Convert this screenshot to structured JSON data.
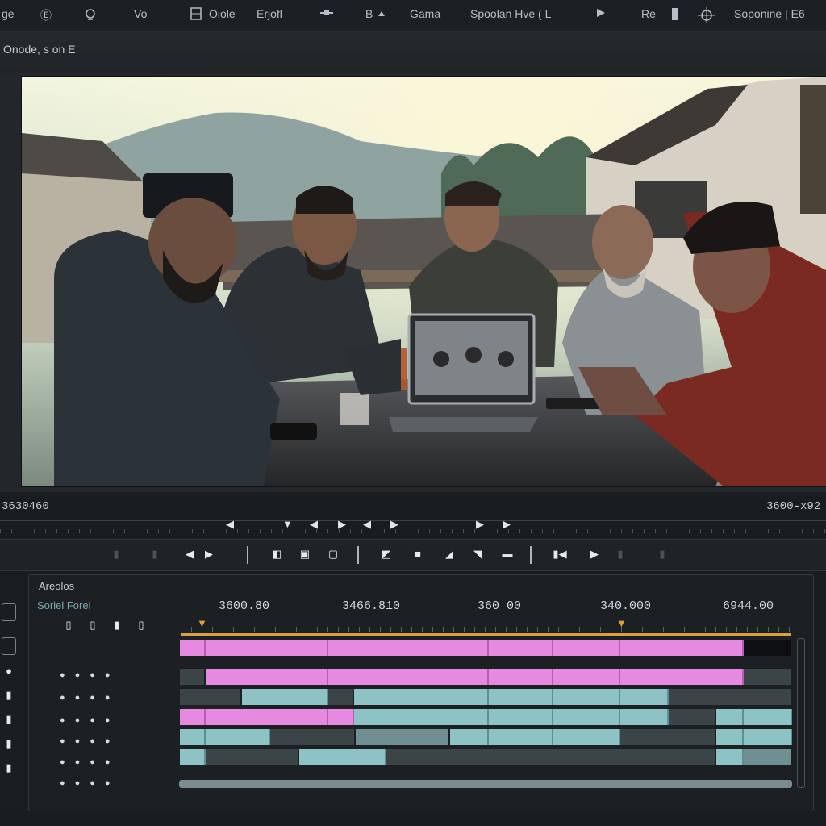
{
  "menu": {
    "items": [
      "ge",
      "Ⓔ",
      "",
      "Vo",
      "",
      "Oiole",
      "Erjofl",
      "",
      "B",
      "Gama",
      "Spoolan Hve ( L",
      "",
      "Re",
      "",
      "Soponine | E6"
    ]
  },
  "window": {
    "title": "Onode, s on E"
  },
  "viewer": {
    "timecode_left": "3630460",
    "timecode_right": "3600-x92"
  },
  "timeline": {
    "header_title": "Areolos",
    "header_subtitle": "Soriel Forel",
    "ruler_labels": [
      "3600.80",
      "3466.810",
      "360 00",
      "340.000",
      "6944.00"
    ]
  },
  "colors": {
    "accent": "#d9a23a",
    "clip_pink": "#e58ae0",
    "clip_teal": "#8ec3c6"
  },
  "icons": {
    "transport": [
      "skip-back-icon",
      "marker-icon",
      "step-back-icon",
      "play-icon",
      "step-back-icon",
      "play-icon",
      "play-icon",
      "play-icon"
    ],
    "tools": [
      "clip-icon",
      "film-icon",
      "frame-icon",
      "trim-icon",
      "stop-icon",
      "slip-icon",
      "razor-icon",
      "line-icon",
      "mark-in-icon",
      "play-icon"
    ]
  }
}
